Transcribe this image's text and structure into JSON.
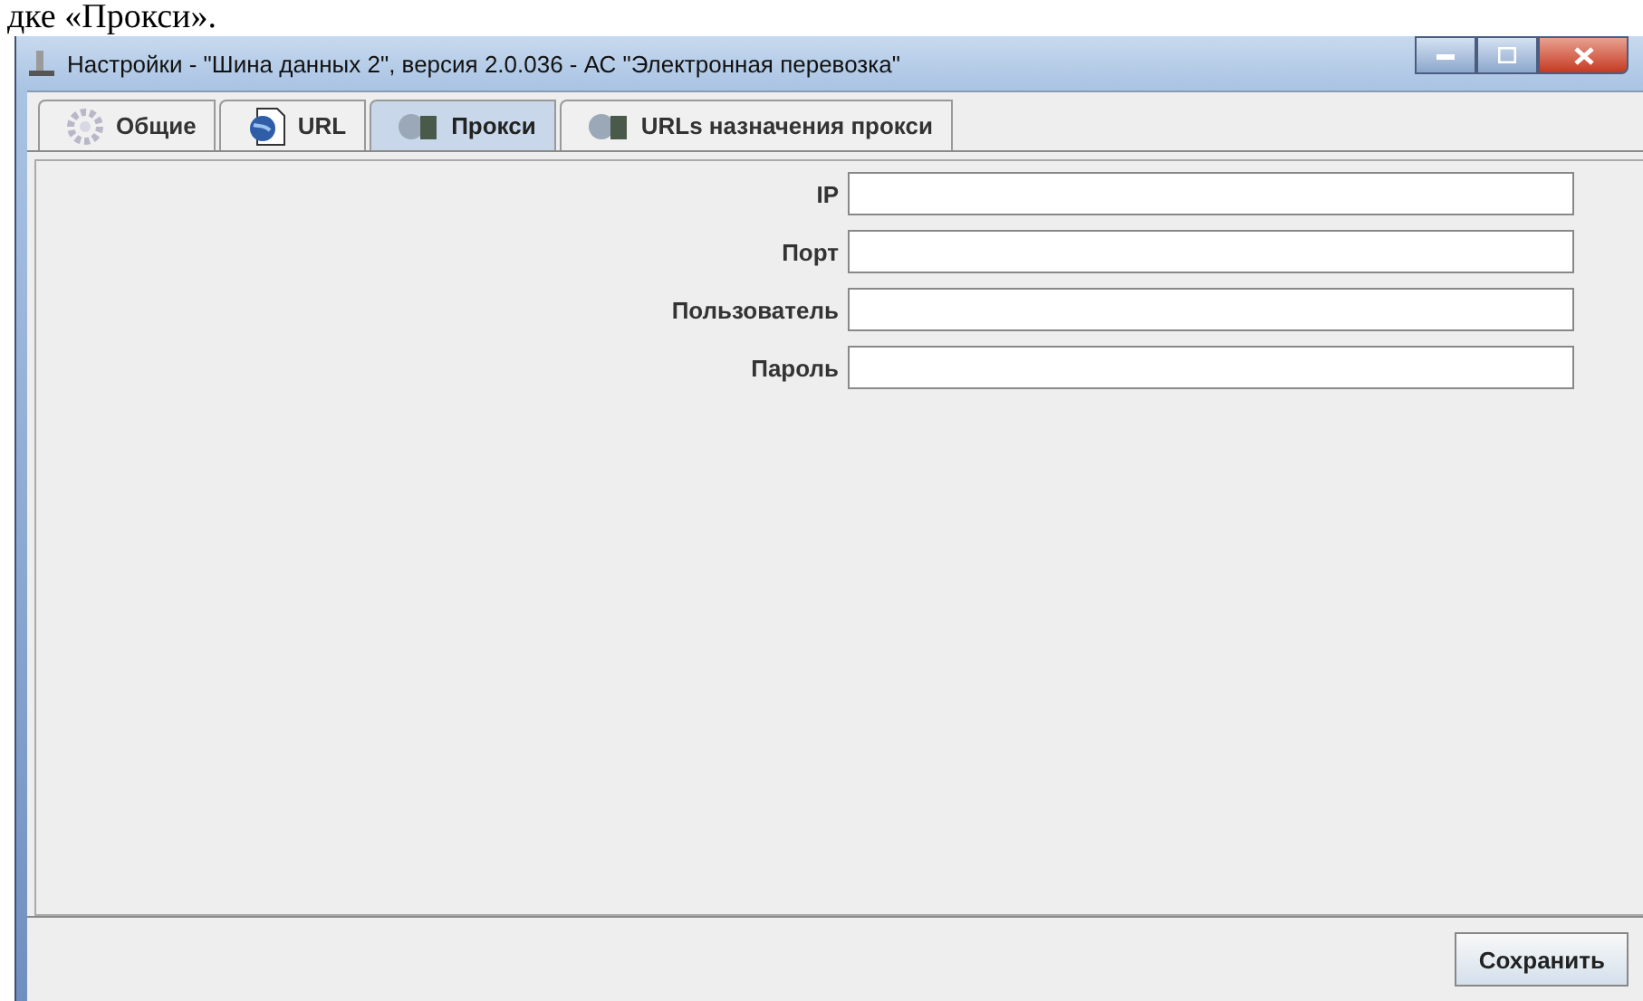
{
  "caption": "дке «Прокси».",
  "window": {
    "title": "Настройки - \"Шина данных 2\", версия 2.0.036 - АС \"Электронная перевозка\""
  },
  "tabs": [
    {
      "label": "Общие",
      "kind": "gear",
      "selected": false
    },
    {
      "label": "URL",
      "kind": "globe",
      "selected": false
    },
    {
      "label": "Прокси",
      "kind": "proxy",
      "selected": true
    },
    {
      "label": "URLs назначения прокси",
      "kind": "proxy",
      "selected": false
    }
  ],
  "fields": [
    {
      "label": "IP"
    },
    {
      "label": "Порт"
    },
    {
      "label": "Пользователь"
    },
    {
      "label": "Пароль"
    }
  ],
  "buttons": [
    "Сохранить"
  ]
}
